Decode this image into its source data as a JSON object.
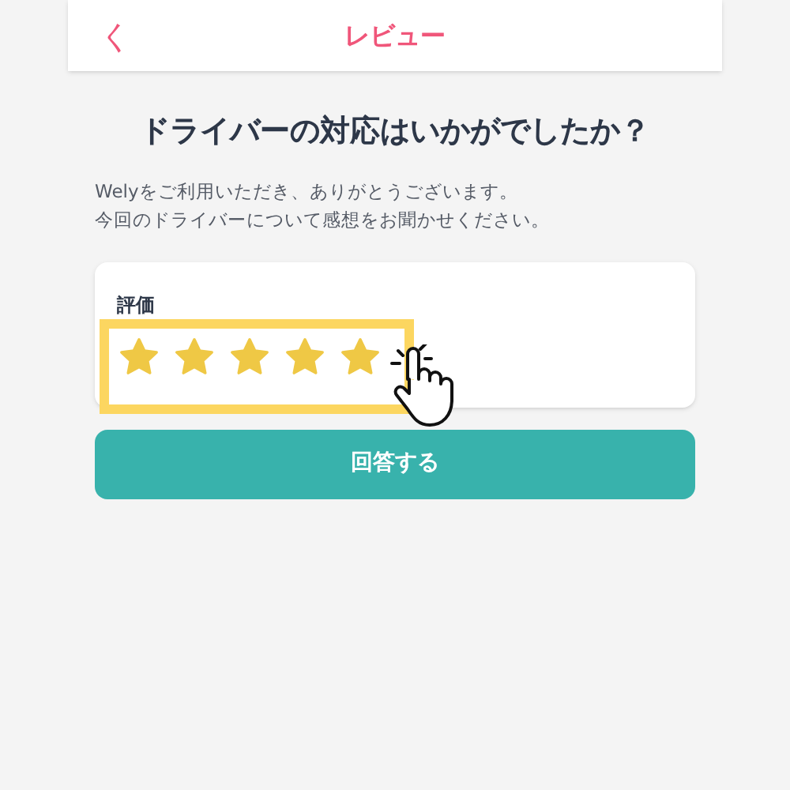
{
  "header": {
    "back": "く",
    "title": "レビュー"
  },
  "question": "ドライバーの対応はいかがでしたか？",
  "message": [
    "Welyをご利用いただき、ありがとうございます。",
    "今回のドライバーについて感想をお聞かせください。"
  ],
  "rating": {
    "label": "評価",
    "stars": 5
  },
  "submit": "回答する"
}
